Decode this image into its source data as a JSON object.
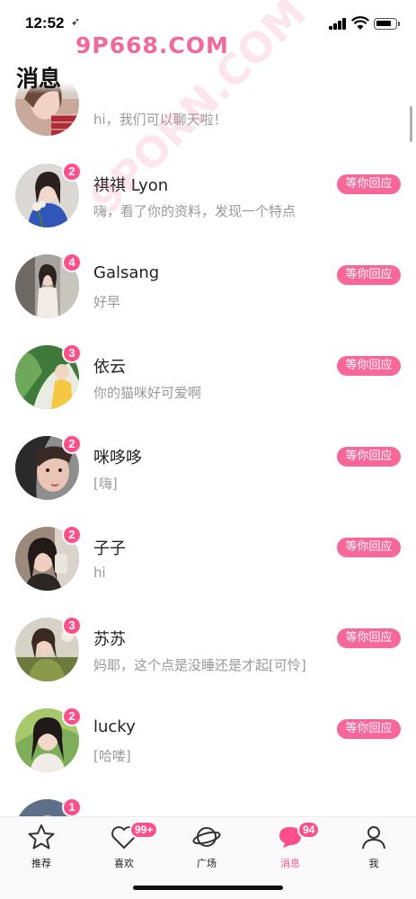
{
  "status_bar": {
    "time": "12:52",
    "location_glyph": "➶"
  },
  "watermark": {
    "text": "9P668.COM",
    "diagonal": "9PORN.COM"
  },
  "header": {
    "title": "消息"
  },
  "messages": [
    {
      "name": "",
      "text": "hi，我们可以聊天啦！",
      "badge": "",
      "reply": ""
    },
    {
      "name": "祺祺 Lyon",
      "text": "嗨，看了你的资料，发现一个特点",
      "badge": "2",
      "reply": "等你回应"
    },
    {
      "name": "Galsang",
      "text": "好早",
      "badge": "4",
      "reply": "等你回应"
    },
    {
      "name": "依云",
      "text": "你的猫咪好可爱啊",
      "badge": "3",
      "reply": "等你回应"
    },
    {
      "name": "咪哆哆",
      "text": "[嗨]",
      "badge": "2",
      "reply": "等你回应"
    },
    {
      "name": "子子",
      "text": "hi",
      "badge": "2",
      "reply": "等你回应"
    },
    {
      "name": "苏苏",
      "text": "妈耶，这个点是没睡还是才起[可怜]",
      "badge": "3",
      "reply": "等你回应"
    },
    {
      "name": "lucky",
      "text": "[哈喽]",
      "badge": "2",
      "reply": "等你回应"
    },
    {
      "name": "",
      "text": "",
      "badge": "1",
      "reply": ""
    }
  ],
  "tabbar": {
    "tabs": [
      {
        "label": "推荐",
        "icon": "star-icon",
        "badge": ""
      },
      {
        "label": "喜欢",
        "icon": "heart-icon",
        "badge": "99+"
      },
      {
        "label": "广场",
        "icon": "planet-icon",
        "badge": ""
      },
      {
        "label": "消息",
        "icon": "chat-icon",
        "badge": "94"
      },
      {
        "label": "我",
        "icon": "person-icon",
        "badge": ""
      }
    ],
    "active_index": 3
  },
  "colors": {
    "accent": "#ff4f8b",
    "reply_button": "#f7679a",
    "secondary_text": "#999999"
  }
}
